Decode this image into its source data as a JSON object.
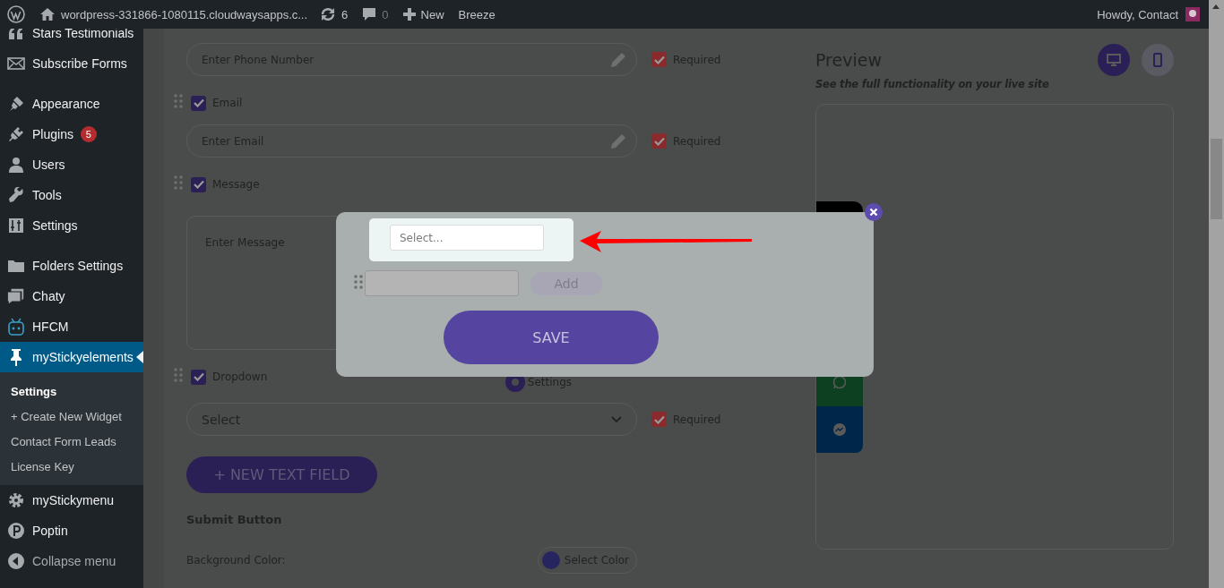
{
  "admin_bar": {
    "site_name": "wordpress-331866-1080115.cloudwaysapps.c...",
    "updates_count": "6",
    "comments_count": "0",
    "new_label": "New",
    "breeze_label": "Breeze",
    "greeting": "Howdy, Contact"
  },
  "sidebar": {
    "groups": [
      {
        "items": [
          {
            "label": "Stars Testimonials",
            "selected": false
          },
          {
            "label": "Subscribe Forms",
            "selected": false
          }
        ]
      },
      {
        "items": [
          {
            "label": "Appearance",
            "selected": false
          },
          {
            "label": "Plugins",
            "selected": false,
            "badge": "5"
          },
          {
            "label": "Users",
            "selected": false
          },
          {
            "label": "Tools",
            "selected": false
          },
          {
            "label": "Settings",
            "selected": false
          }
        ]
      },
      {
        "items": [
          {
            "label": "Folders Settings",
            "selected": false
          },
          {
            "label": "Chaty",
            "selected": false
          },
          {
            "label": "HFCM",
            "selected": false
          },
          {
            "label": "myStickyelements",
            "selected": true,
            "children": [
              {
                "label": "Settings",
                "selected": true
              },
              {
                "label": "+ Create New Widget",
                "selected": false
              },
              {
                "label": "Contact Form Leads",
                "selected": false
              },
              {
                "label": "License Key",
                "selected": false
              }
            ]
          },
          {
            "label": "myStickymenu",
            "selected": false
          },
          {
            "label": "Poptin",
            "selected": false
          },
          {
            "label": "Collapse menu",
            "selected": false
          }
        ]
      }
    ]
  },
  "form": {
    "fields": [
      {
        "kind": "text",
        "placeholder": "Enter Phone Number",
        "required": true,
        "required_label": "Required"
      },
      {
        "kind": "text",
        "label": "Email",
        "checked": true,
        "placeholder": "Enter Email",
        "required": true,
        "required_label": "Required"
      },
      {
        "kind": "textarea",
        "label": "Message",
        "checked": true,
        "placeholder": "Enter Message"
      },
      {
        "kind": "select",
        "label": "Dropdown",
        "checked": true,
        "settings_label": "Settings",
        "value": "Select",
        "required": true,
        "required_label": "Required"
      }
    ],
    "new_field_button": "+ NEW TEXT FIELD",
    "submit_title": "Submit Button",
    "background_color_label": "Background Color:",
    "select_color_button": "Select Color"
  },
  "preview": {
    "title": "Preview",
    "subtitle": "See the full functionality on your live site",
    "devices": [
      {
        "kind": "desktop",
        "selected": true
      },
      {
        "kind": "mobile",
        "selected": false
      }
    ],
    "channels": [
      {
        "kind": "whatsapp",
        "color": "#0c4020"
      },
      {
        "kind": "messenger",
        "color": "#00264a"
      }
    ]
  },
  "modal": {
    "select_placeholder": "Select...",
    "add_label": "Add",
    "save_label": "SAVE"
  }
}
